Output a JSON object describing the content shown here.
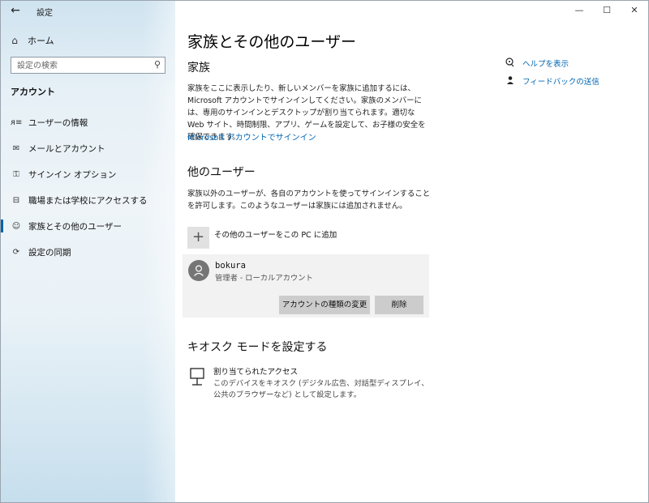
{
  "window": {
    "app_title": "設定",
    "back_icon": "back-arrow-icon",
    "controls": {
      "minimize": "—",
      "maximize": "☐",
      "close": "✕"
    }
  },
  "sidebar": {
    "home_label": "ホーム",
    "search_placeholder": "設定の検索",
    "section_title": "アカウント",
    "items": [
      {
        "label": "ユーザーの情報",
        "icon": "user-info-icon",
        "glyph": "ᴙ≡"
      },
      {
        "label": "メールとアカウント",
        "icon": "mail-icon",
        "glyph": "✉"
      },
      {
        "label": "サインイン オプション",
        "icon": "key-icon",
        "glyph": "⚿"
      },
      {
        "label": "職場または学校にアクセスする",
        "icon": "briefcase-icon",
        "glyph": "⊟"
      },
      {
        "label": "家族とその他のユーザー",
        "icon": "person-icon",
        "glyph": "☺",
        "active": true
      },
      {
        "label": "設定の同期",
        "icon": "sync-icon",
        "glyph": "⟳"
      }
    ]
  },
  "main": {
    "page_title": "家族とその他のユーザー",
    "family": {
      "heading": "家族",
      "paragraph": "家族をここに表示したり、新しいメンバーを家族に追加するには、Microsoft アカウントでサインインしてください。家族のメンバーには、専用のサインインとデスクトップが割り当てられます。適切な Web サイト、時間制限、アプリ、ゲームを設定して、お子様の安全を確保できます。",
      "link": "Microsoft アカウントでサインイン"
    },
    "others": {
      "heading": "他のユーザー",
      "paragraph": "家族以外のユーザーが、各自のアカウントを使ってサインインすることを許可します。このようなユーザーは家族には追加されません。",
      "add_label": "その他のユーザーをこの PC に追加",
      "add_glyph": "+",
      "user": {
        "name": "bokura",
        "role": "管理者 - ローカルアカウント",
        "change_button": "アカウントの種類の変更",
        "delete_button": "削除"
      }
    },
    "kiosk": {
      "heading": "キオスク モードを設定する",
      "title": "割り当てられたアクセス",
      "description": "このデバイスをキオスク (デジタル広告、対話型ディスプレイ、公共のブラウザーなど) として設定します。"
    },
    "help": [
      {
        "label": "ヘルプを表示",
        "icon": "help-chat-icon"
      },
      {
        "label": "フィードバックの送信",
        "icon": "feedback-icon"
      }
    ]
  }
}
